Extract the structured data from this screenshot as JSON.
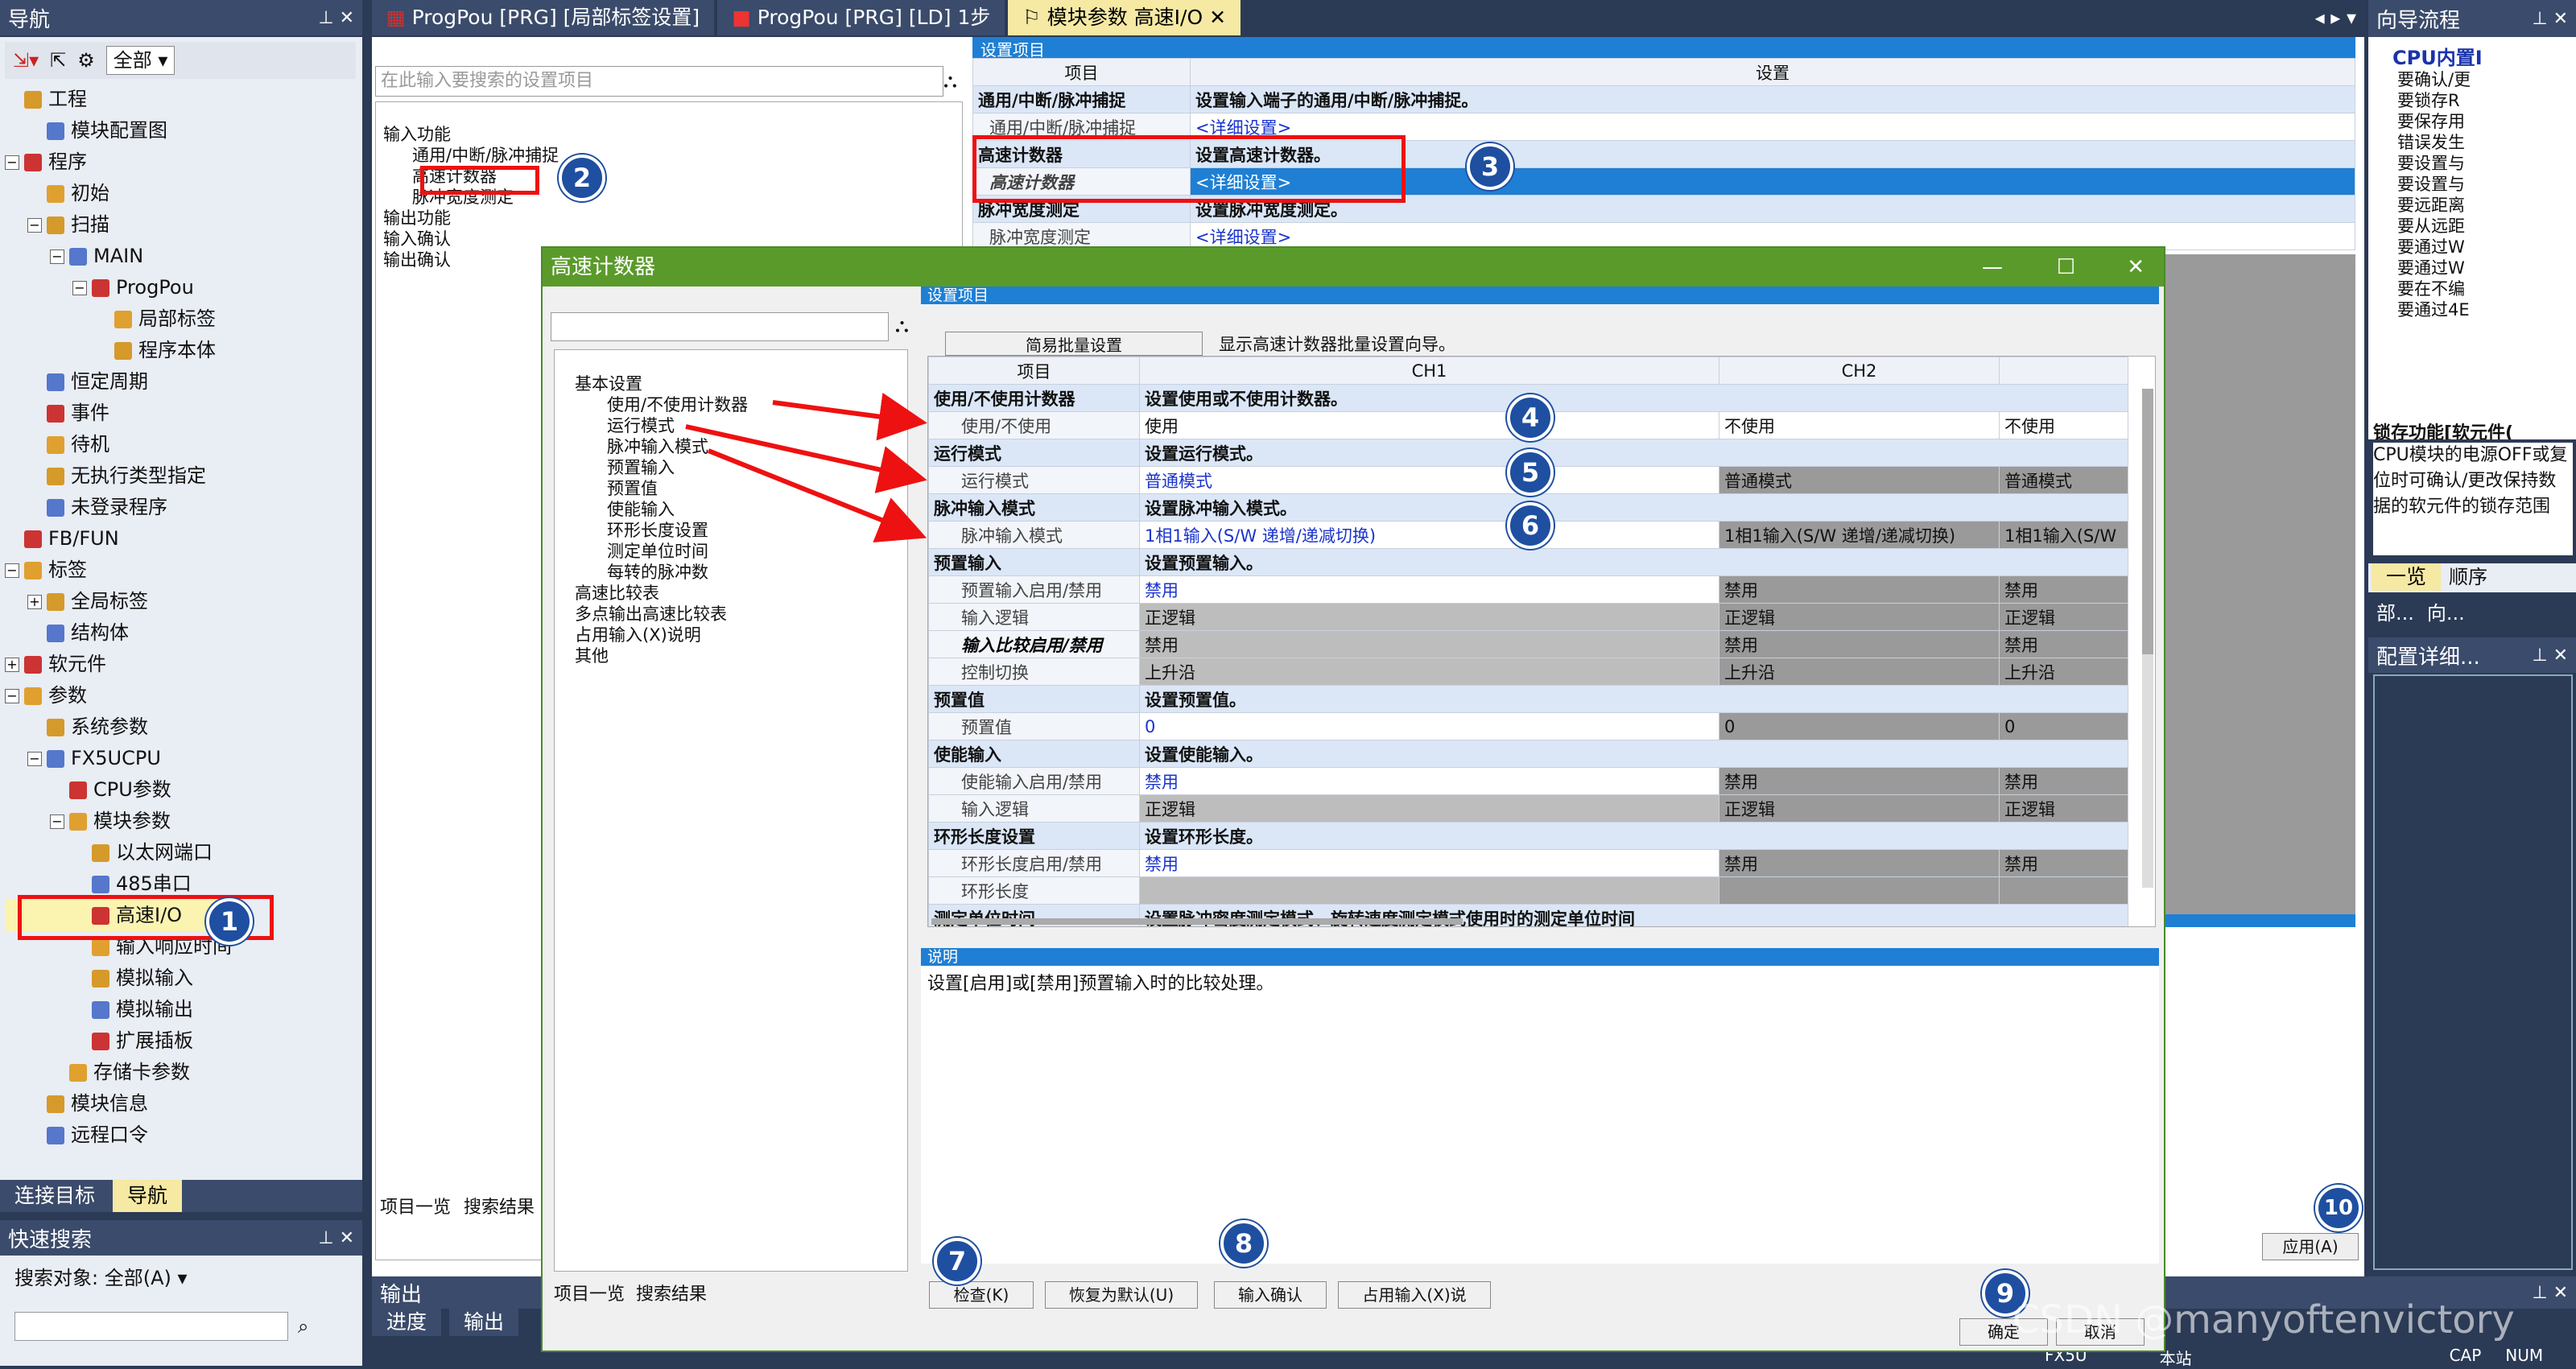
{
  "nav": {
    "title": "导航",
    "toolbar_filter": "全部",
    "items": [
      {
        "label": "工程",
        "lvl": 0,
        "tog": ""
      },
      {
        "label": "模块配置图",
        "lvl": 1,
        "tog": ""
      },
      {
        "label": "程序",
        "lvl": 0,
        "tog": "−"
      },
      {
        "label": "初始",
        "lvl": 1,
        "tog": ""
      },
      {
        "label": "扫描",
        "lvl": 1,
        "tog": "−"
      },
      {
        "label": "MAIN",
        "lvl": 2,
        "tog": "−"
      },
      {
        "label": "ProgPou",
        "lvl": 3,
        "tog": "−"
      },
      {
        "label": "局部标签",
        "lvl": 4,
        "tog": ""
      },
      {
        "label": "程序本体",
        "lvl": 4,
        "tog": ""
      },
      {
        "label": "恒定周期",
        "lvl": 1,
        "tog": ""
      },
      {
        "label": "事件",
        "lvl": 1,
        "tog": ""
      },
      {
        "label": "待机",
        "lvl": 1,
        "tog": ""
      },
      {
        "label": "无执行类型指定",
        "lvl": 1,
        "tog": ""
      },
      {
        "label": "未登录程序",
        "lvl": 1,
        "tog": ""
      },
      {
        "label": "FB/FUN",
        "lvl": 0,
        "tog": ""
      },
      {
        "label": "标签",
        "lvl": 0,
        "tog": "−"
      },
      {
        "label": "全局标签",
        "lvl": 1,
        "tog": "+"
      },
      {
        "label": "结构体",
        "lvl": 1,
        "tog": ""
      },
      {
        "label": "软元件",
        "lvl": 0,
        "tog": "+"
      },
      {
        "label": "参数",
        "lvl": 0,
        "tog": "−"
      },
      {
        "label": "系统参数",
        "lvl": 1,
        "tog": ""
      },
      {
        "label": "FX5UCPU",
        "lvl": 1,
        "tog": "−"
      },
      {
        "label": "CPU参数",
        "lvl": 2,
        "tog": ""
      },
      {
        "label": "模块参数",
        "lvl": 2,
        "tog": "−"
      },
      {
        "label": "以太网端口",
        "lvl": 3,
        "tog": ""
      },
      {
        "label": "485串口",
        "lvl": 3,
        "tog": ""
      },
      {
        "label": "高速I/O",
        "lvl": 3,
        "tog": ""
      },
      {
        "label": "输入响应时间",
        "lvl": 3,
        "tog": ""
      },
      {
        "label": "模拟输入",
        "lvl": 3,
        "tog": ""
      },
      {
        "label": "模拟输出",
        "lvl": 3,
        "tog": ""
      },
      {
        "label": "扩展插板",
        "lvl": 3,
        "tog": ""
      },
      {
        "label": "存储卡参数",
        "lvl": 2,
        "tog": ""
      },
      {
        "label": "模块信息",
        "lvl": 1,
        "tog": ""
      },
      {
        "label": "远程口令",
        "lvl": 1,
        "tog": ""
      }
    ],
    "bottom_tabs": [
      "连接目标",
      "导航"
    ]
  },
  "quick": {
    "title": "快速搜索",
    "target": "搜索对象: 全部(A)"
  },
  "tabs": [
    "ProgPou [PRG] [局部标签设置]",
    "ProgPou [PRG] [LD] 1步",
    "模块参数 高速I/O"
  ],
  "bg": {
    "search_placeholder": "在此输入要搜索的设置项目",
    "tree": [
      "输入功能",
      "通用/中断/脉冲捕捉",
      "高速计数器",
      "脉冲宽度测定",
      "输出功能",
      "输入确认",
      "输出确认"
    ],
    "settings_title": "设置项目",
    "col_item": "项目",
    "col_set": "设置",
    "rows": [
      {
        "k": "通用/中断/脉冲捕捉",
        "v": "设置输入端子的通用/中断/脉冲捕捉。",
        "sec": true
      },
      {
        "k": "通用/中断/脉冲捕捉",
        "v": "<详细设置>",
        "sec": false
      },
      {
        "k": "高速计数器",
        "v": "设置高速计数器。",
        "sec": true
      },
      {
        "k": "高速计数器",
        "v": "<详细设置>",
        "sec": false
      },
      {
        "k": "脉冲宽度测定",
        "v": "设置脉冲宽度测定。",
        "sec": true
      },
      {
        "k": "脉冲宽度测定",
        "v": "<详细设置>",
        "sec": false
      }
    ],
    "bottom_tabs": [
      "项目一览",
      "搜索结果"
    ]
  },
  "right": {
    "title": "向导流程",
    "heading": "CPU内置I",
    "items": [
      "要确认/更",
      "要锁存R",
      "要保存用",
      "错误发生",
      "要设置与",
      "要设置与",
      "要远距离",
      "要从远距",
      "要通过W",
      "要通过W",
      "要在不编",
      "要通过4E"
    ],
    "func_title": "锁存功能[软元件(",
    "func_text": "CPU模块的电源OFF或复位时可确认/更改保持数据的软元件的锁存范围",
    "tabs": [
      "一览",
      "顺序"
    ],
    "tabs2": [
      "部...",
      "向..."
    ],
    "detail": "配置详细...",
    "apply": "应用(A)"
  },
  "dialog": {
    "title": "高速计数器",
    "settings_title": "设置项目",
    "batch_btn": "简易批量设置",
    "batch_desc": "显示高速计数器批量设置向导。",
    "tree": [
      "基本设置",
      "使用/不使用计数器",
      "运行模式",
      "脉冲输入模式",
      "预置输入",
      "预置值",
      "使能输入",
      "环形长度设置",
      "测定单位时间",
      "每转的脉冲数",
      "高速比较表",
      "多点输出高速比较表",
      "占用输入(X)说明",
      "其他"
    ],
    "cols": [
      "项目",
      "CH1",
      "CH2"
    ],
    "rows": [
      {
        "t": "sec",
        "k": "使用/不使用计数器",
        "v": "设置使用或不使用计数器。"
      },
      {
        "t": "row",
        "k": "使用/不使用",
        "c1": "使用",
        "c2": "不使用",
        "c3": "不使用",
        "blue": false,
        "c23blue": true
      },
      {
        "t": "sec",
        "k": "运行模式",
        "v": "设置运行模式。"
      },
      {
        "t": "row",
        "k": "运行模式",
        "c1": "普通模式",
        "c2": "普通模式",
        "c3": "普通模式",
        "blue": true
      },
      {
        "t": "sec",
        "k": "脉冲输入模式",
        "v": "设置脉冲输入模式。"
      },
      {
        "t": "row",
        "k": "脉冲输入模式",
        "c1": "1相1输入(S/W 递增/递减切换)",
        "c2": "1相1输入(S/W 递增/递减切换)",
        "c3": "1相1输入(S/W",
        "blue": true
      },
      {
        "t": "sec",
        "k": "预置输入",
        "v": "设置预置输入。"
      },
      {
        "t": "row",
        "k": "预置输入启用/禁用",
        "c1": "禁用",
        "c2": "禁用",
        "c3": "禁用",
        "blue": true
      },
      {
        "t": "row",
        "k": "输入逻辑",
        "c1": "正逻辑",
        "c2": "正逻辑",
        "c3": "正逻辑",
        "dis": true
      },
      {
        "t": "row",
        "k": "输入比较启用/禁用",
        "c1": "禁用",
        "c2": "禁用",
        "c3": "禁用",
        "dis": true,
        "italic": true
      },
      {
        "t": "row",
        "k": "控制切换",
        "c1": "上升沿",
        "c2": "上升沿",
        "c3": "上升沿",
        "dis": true
      },
      {
        "t": "sec",
        "k": "预置值",
        "v": "设置预置值。"
      },
      {
        "t": "row",
        "k": "预置值",
        "c1": "0",
        "c2": "0",
        "c3": "0",
        "blue": true
      },
      {
        "t": "sec",
        "k": "使能输入",
        "v": "设置使能输入。"
      },
      {
        "t": "row",
        "k": "使能输入启用/禁用",
        "c1": "禁用",
        "c2": "禁用",
        "c3": "禁用",
        "blue": true
      },
      {
        "t": "row",
        "k": "输入逻辑",
        "c1": "正逻辑",
        "c2": "正逻辑",
        "c3": "正逻辑",
        "dis": true
      },
      {
        "t": "sec",
        "k": "环形长度设置",
        "v": "设置环形长度。"
      },
      {
        "t": "row",
        "k": "环形长度启用/禁用",
        "c1": "禁用",
        "c2": "禁用",
        "c3": "禁用",
        "blue": true
      },
      {
        "t": "row",
        "k": "环形长度",
        "c1": "",
        "c2": "",
        "c3": "",
        "dis": true
      },
      {
        "t": "sec",
        "k": "测定单位时间",
        "v": "设置脉冲密度测定模式、旋转速度测定模式使用时的测定单位时间"
      }
    ],
    "desc_title": "说明",
    "desc_text": "设置[启用]或[禁用]预置输入时的比较处理。",
    "buttons": [
      "检查(K)",
      "恢复为默认(U)",
      "输入确认",
      "占用输入(X)说",
      "确定",
      "取消"
    ],
    "bottom_tabs": [
      "项目一览",
      "搜索结果"
    ]
  },
  "output": {
    "title": "输出",
    "tabs": [
      "进度",
      "输出"
    ]
  },
  "status": [
    "FX5U",
    "本站",
    "CAP",
    "NUM"
  ],
  "watermark": "CSDN @manyoftenvictory",
  "badges": [
    "1",
    "2",
    "3",
    "4",
    "5",
    "6",
    "7",
    "8",
    "9",
    "10"
  ],
  "colors": {
    "frame": "#2b3a55",
    "dialog_title": "#5a9a2a",
    "accent": "#1f4fa0",
    "highlight": "#e11111"
  }
}
